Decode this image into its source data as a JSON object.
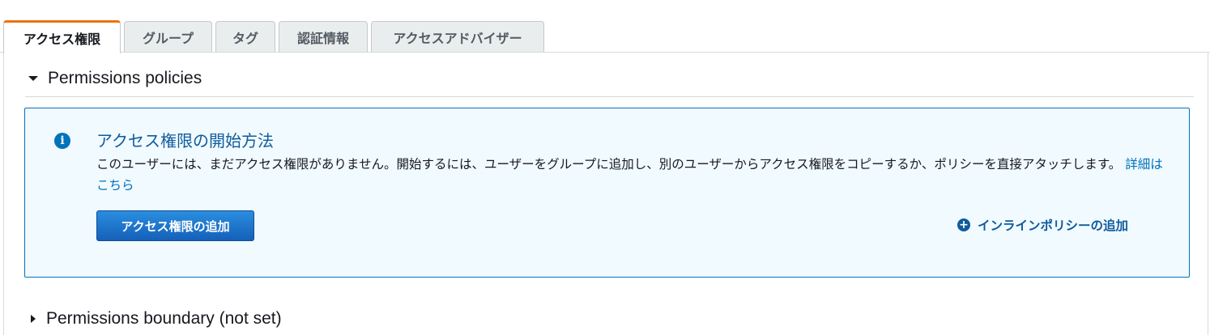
{
  "tabs": [
    {
      "label": "アクセス権限",
      "active": true
    },
    {
      "label": "グループ",
      "active": false
    },
    {
      "label": "タグ",
      "active": false
    },
    {
      "label": "認証情報",
      "active": false
    },
    {
      "label": "アクセスアドバイザー",
      "active": false
    }
  ],
  "permissions_policies": {
    "title": "Permissions policies",
    "expanded": true,
    "info": {
      "icon": "info-icon",
      "title": "アクセス権限の開始方法",
      "body": "このユーザーには、まだアクセス権限がありません。開始するには、ユーザーをグループに追加し、別のユーザーからアクセス権限をコピーするか、ポリシーを直接アタッチします。",
      "link": "詳細はこちら"
    },
    "add_permissions_button": "アクセス権限の追加",
    "add_inline_policy": {
      "icon": "plus-circle-icon",
      "label": "インラインポリシーの追加"
    }
  },
  "permissions_boundary": {
    "title": "Permissions boundary (not set)",
    "expanded": false
  },
  "colors": {
    "active_tab_accent": "#ec7211",
    "info_border": "#0073bb",
    "info_background": "#f1faff",
    "link": "#0073bb",
    "primary_button": "#1a6fcf"
  }
}
